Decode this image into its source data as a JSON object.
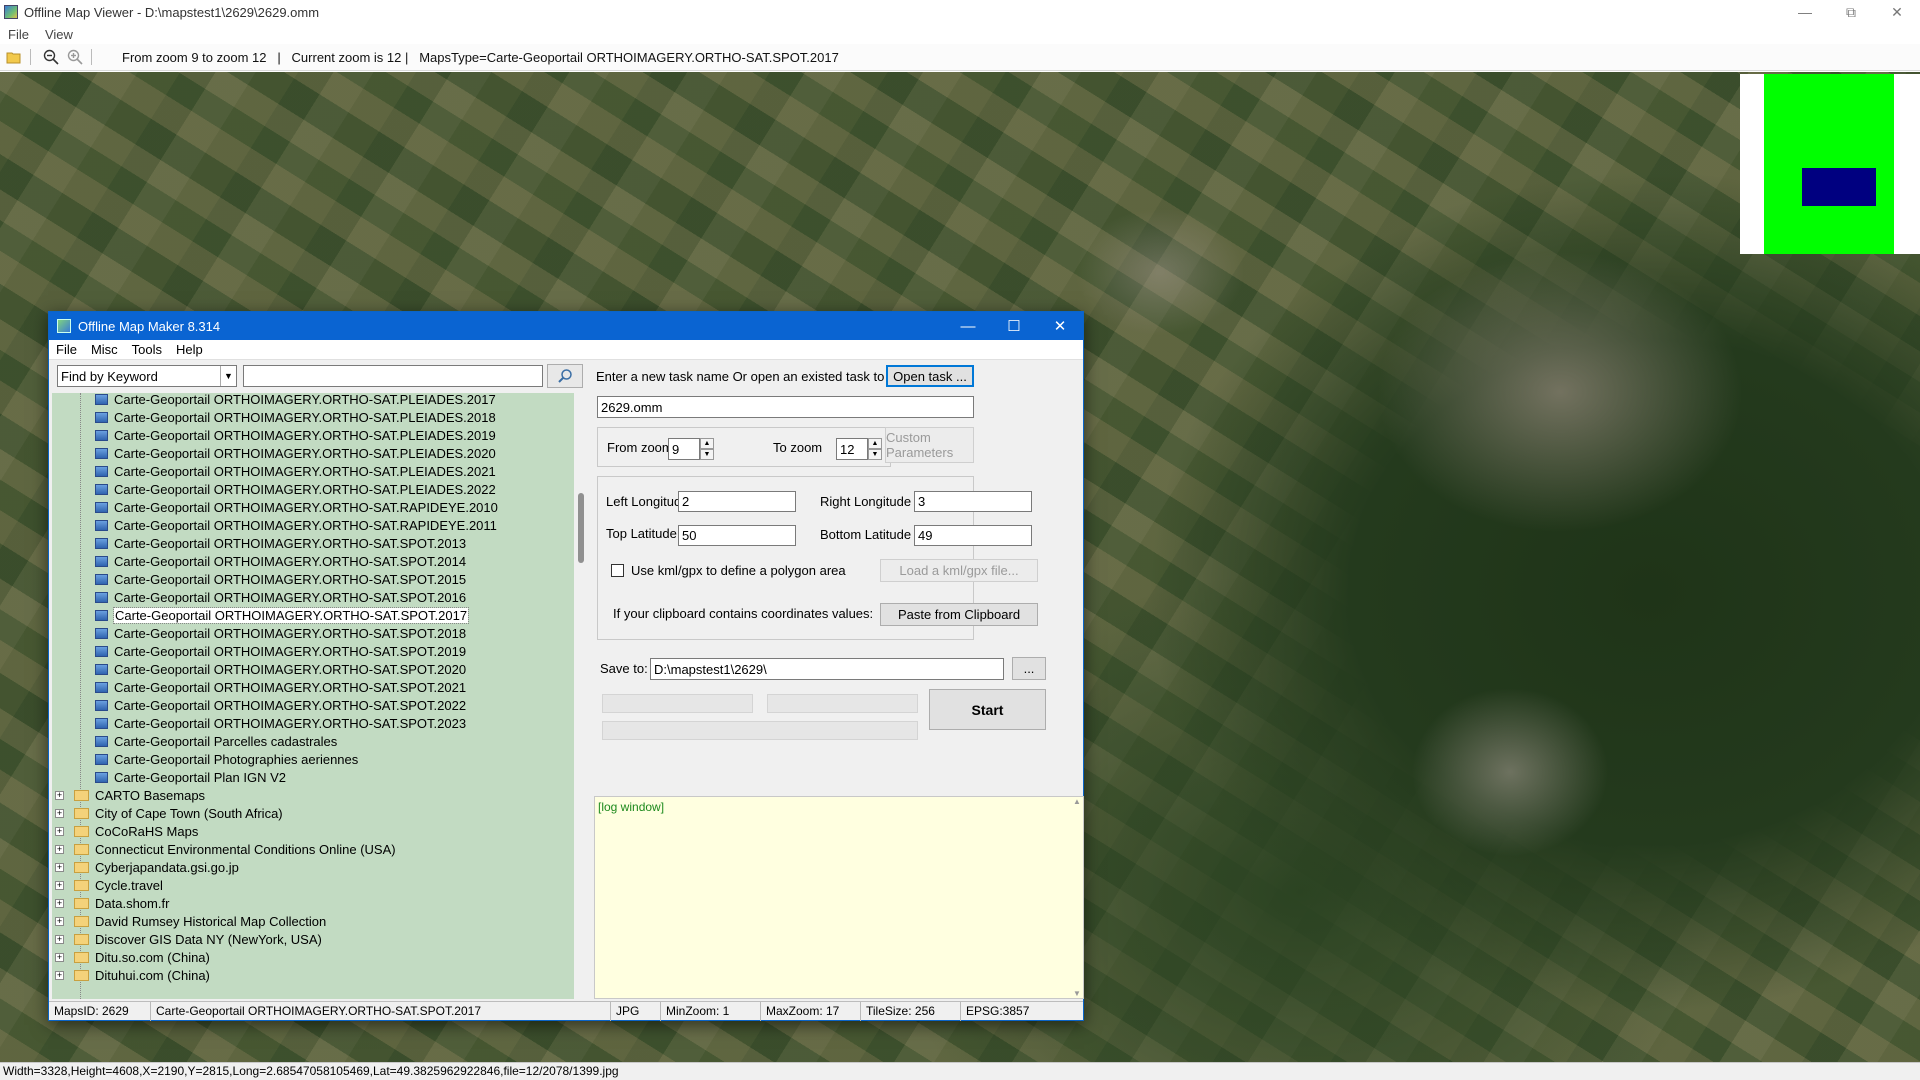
{
  "viewer": {
    "title": "Offline Map Viewer - D:\\mapstest1\\2629\\2629.omm",
    "menu": [
      "File",
      "View"
    ],
    "toolbar_info": "From zoom 9 to zoom 12   |   Current zoom is 12 |   MapsType=Carte-Geoportail ORTHOIMAGERY.ORTHO-SAT.SPOT.2017",
    "status": "Width=3328,Height=4608,X=2190,Y=2815,Long=2.68547058105469,Lat=49.3825962922846,file=12/2078/1399.jpg",
    "minimap_colors": {
      "area": "#00ff00",
      "viewport": "#000080"
    }
  },
  "maker": {
    "title": "Offline Map Maker 8.314",
    "menu": [
      "File",
      "Misc",
      "Tools",
      "Help"
    ],
    "search": {
      "mode": "Find by Keyword",
      "keyword": ""
    },
    "tree": {
      "children": [
        "Carte-Geoportail ORTHOIMAGERY.ORTHO-SAT.PLEIADES.2017",
        "Carte-Geoportail ORTHOIMAGERY.ORTHO-SAT.PLEIADES.2018",
        "Carte-Geoportail ORTHOIMAGERY.ORTHO-SAT.PLEIADES.2019",
        "Carte-Geoportail ORTHOIMAGERY.ORTHO-SAT.PLEIADES.2020",
        "Carte-Geoportail ORTHOIMAGERY.ORTHO-SAT.PLEIADES.2021",
        "Carte-Geoportail ORTHOIMAGERY.ORTHO-SAT.PLEIADES.2022",
        "Carte-Geoportail ORTHOIMAGERY.ORTHO-SAT.RAPIDEYE.2010",
        "Carte-Geoportail ORTHOIMAGERY.ORTHO-SAT.RAPIDEYE.2011",
        "Carte-Geoportail ORTHOIMAGERY.ORTHO-SAT.SPOT.2013",
        "Carte-Geoportail ORTHOIMAGERY.ORTHO-SAT.SPOT.2014",
        "Carte-Geoportail ORTHOIMAGERY.ORTHO-SAT.SPOT.2015",
        "Carte-Geoportail ORTHOIMAGERY.ORTHO-SAT.SPOT.2016",
        "Carte-Geoportail ORTHOIMAGERY.ORTHO-SAT.SPOT.2017",
        "Carte-Geoportail ORTHOIMAGERY.ORTHO-SAT.SPOT.2018",
        "Carte-Geoportail ORTHOIMAGERY.ORTHO-SAT.SPOT.2019",
        "Carte-Geoportail ORTHOIMAGERY.ORTHO-SAT.SPOT.2020",
        "Carte-Geoportail ORTHOIMAGERY.ORTHO-SAT.SPOT.2021",
        "Carte-Geoportail ORTHOIMAGERY.ORTHO-SAT.SPOT.2022",
        "Carte-Geoportail ORTHOIMAGERY.ORTHO-SAT.SPOT.2023",
        "Carte-Geoportail Parcelles cadastrales",
        "Carte-Geoportail Photographies aeriennes",
        "Carte-Geoportail Plan IGN V2"
      ],
      "selected_child": "Carte-Geoportail ORTHOIMAGERY.ORTHO-SAT.SPOT.2017",
      "folders": [
        "CARTO Basemaps",
        "City of Cape Town (South Africa)",
        "CoCoRaHS Maps",
        "Connecticut Environmental Conditions Online (USA)",
        "Cyberjapandata.gsi.go.jp",
        "Cycle.travel",
        "Data.shom.fr",
        "David Rumsey Historical Map Collection",
        "Discover GIS Data NY (NewYork, USA)",
        "Ditu.so.com (China)",
        "Dituhui.com (China)"
      ]
    },
    "task_prompt": "Enter a new task name Or open an existed task to continue:",
    "open_task_label": "Open task ...",
    "task_name": "2629.omm",
    "from_zoom_label": "From zoom",
    "from_zoom": "9",
    "to_zoom_label": "To zoom",
    "to_zoom": "12",
    "custom_params_label": "Custom Parameters",
    "left_lon_label": "Left Longitude",
    "left_lon": "2",
    "right_lon_label": "Right Longitude",
    "right_lon": "3",
    "top_lat_label": "Top Latitude",
    "top_lat": "50",
    "bottom_lat_label": "Bottom Latitude",
    "bottom_lat": "49",
    "kml_label": "Use kml/gpx to define a polygon area",
    "load_kml_label": "Load a kml/gpx file...",
    "clipboard_prompt": "If your clipboard contains coordinates values:",
    "paste_label": "Paste from Clipboard",
    "save_to_label": "Save to:",
    "save_to": "D:\\mapstest1\\2629\\",
    "browse_label": "...",
    "start_label": "Start",
    "log_text": "[log window]",
    "status": {
      "maps_id": "MapsID: 2629",
      "maps_name": "Carte-Geoportail ORTHOIMAGERY.ORTHO-SAT.SPOT.2017",
      "format": "JPG",
      "min_zoom": "MinZoom: 1",
      "max_zoom": "MaxZoom: 17",
      "tile_size": "TileSize: 256",
      "epsg": "EPSG:3857"
    }
  }
}
